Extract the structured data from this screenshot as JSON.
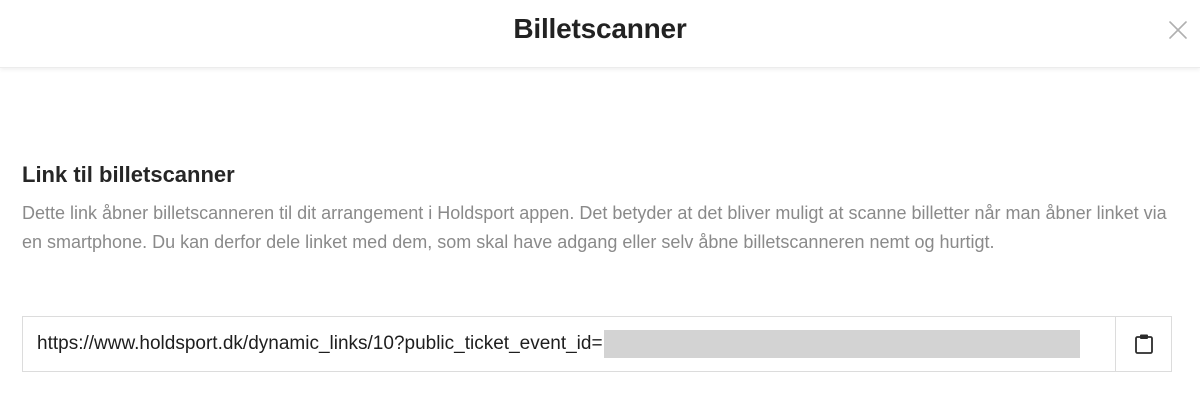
{
  "modal": {
    "title": "Billetscanner",
    "close_icon": "close-icon"
  },
  "section": {
    "title": "Link til billetscanner",
    "description": "Dette link åbner billetscanneren til dit arrangement i Holdsport appen. Det betyder at det bliver muligt at scanne billetter når man åbner linket via en smartphone. Du kan derfor dele linket med dem, som skal have adgang eller selv åbne billetscanneren nemt og hurtigt."
  },
  "link": {
    "value": "https://www.holdsport.dk/dynamic_links/10?public_ticket_event_id=",
    "copy_icon": "clipboard-icon"
  },
  "colors": {
    "title": "#222222",
    "description": "#8a8a8a",
    "border": "#dcdcdc",
    "redaction": "#d3d3d3"
  }
}
